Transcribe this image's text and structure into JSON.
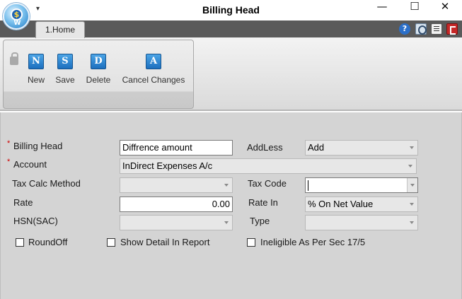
{
  "window": {
    "title": "Billing Head",
    "quick_access_glyph": "▾",
    "minimize_glyph": "—",
    "maximize_glyph": "☐",
    "close_glyph": "✕",
    "logo_letter": "$",
    "logo_wing": "W"
  },
  "ribbon": {
    "tabs": [
      {
        "label": "1.Home",
        "active": true
      }
    ],
    "help_glyph": "?",
    "buttons": [
      {
        "label": "New",
        "icon": "new-icon",
        "glyph": "N"
      },
      {
        "label": "Save",
        "icon": "save-icon",
        "glyph": "S"
      },
      {
        "label": "Delete",
        "icon": "delete-icon",
        "glyph": "D"
      },
      {
        "label": "Cancel Changes",
        "icon": "cancel-changes-icon",
        "glyph": "A"
      }
    ],
    "right_icons": [
      "help-icon",
      "support-icon",
      "document-icon",
      "exit-icon"
    ]
  },
  "form": {
    "required_marker": "*",
    "billing_head": {
      "label": "Billing Head",
      "value": "Diffrence amount",
      "required": true
    },
    "add_less": {
      "label": "AddLess",
      "value": "Add"
    },
    "account": {
      "label": "Account",
      "value": "InDirect Expenses A/c",
      "required": true
    },
    "tax_calc_method": {
      "label": "Tax Calc Method",
      "value": ""
    },
    "tax_code": {
      "label": "Tax Code",
      "value": ""
    },
    "rate": {
      "label": "Rate",
      "value": "0.00"
    },
    "rate_in": {
      "label": "Rate In",
      "value": "% On Net Value"
    },
    "hsn_sac": {
      "label": "HSN(SAC)",
      "value": ""
    },
    "type": {
      "label": "Type",
      "value": ""
    },
    "checkboxes": {
      "round_off": {
        "label": "RoundOff",
        "checked": false
      },
      "show_detail": {
        "label": "Show Detail In Report",
        "checked": false
      },
      "ineligible": {
        "label": "Ineligible As Per Sec 17/5",
        "checked": false
      }
    }
  },
  "colors": {
    "ribbon_icon": "#1c6fbe",
    "form_background": "#d4d4d4",
    "tab_strip": "#5a5a5a",
    "required": "#d00000"
  }
}
